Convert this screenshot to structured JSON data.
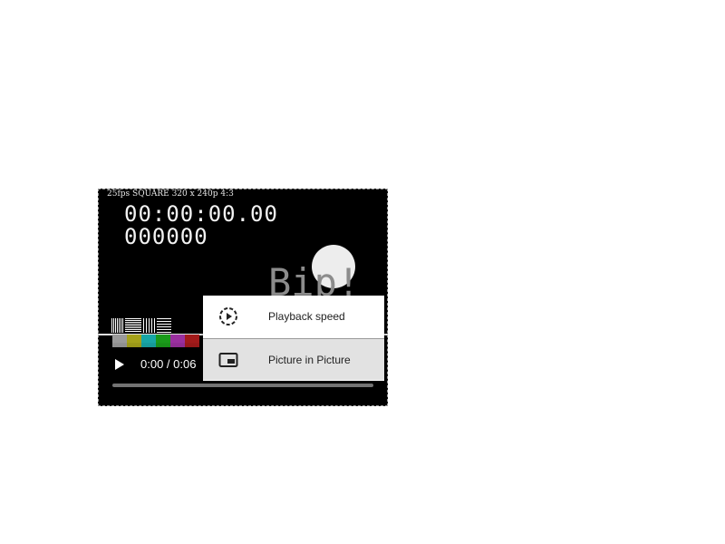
{
  "video": {
    "format_overlay": "25fps SQUARE 320 x 240p 4:3",
    "timecode": "00:00:00.00",
    "frame_counter": "000000",
    "beep_text": "Bip!",
    "color_bars": [
      "#9a9a9a",
      "#a5a21a",
      "#18a6a6",
      "#1a9a1a",
      "#9a2f9f",
      "#a21a1a"
    ]
  },
  "controls": {
    "play_icon": "play-icon",
    "time_display": "0:00 / 0:06",
    "progress": 0
  },
  "context_menu": {
    "items": [
      {
        "label": "Playback speed",
        "icon": "playback-speed-icon",
        "highlighted": false
      },
      {
        "label": "Picture in Picture",
        "icon": "picture-in-picture-icon",
        "highlighted": true
      }
    ]
  }
}
